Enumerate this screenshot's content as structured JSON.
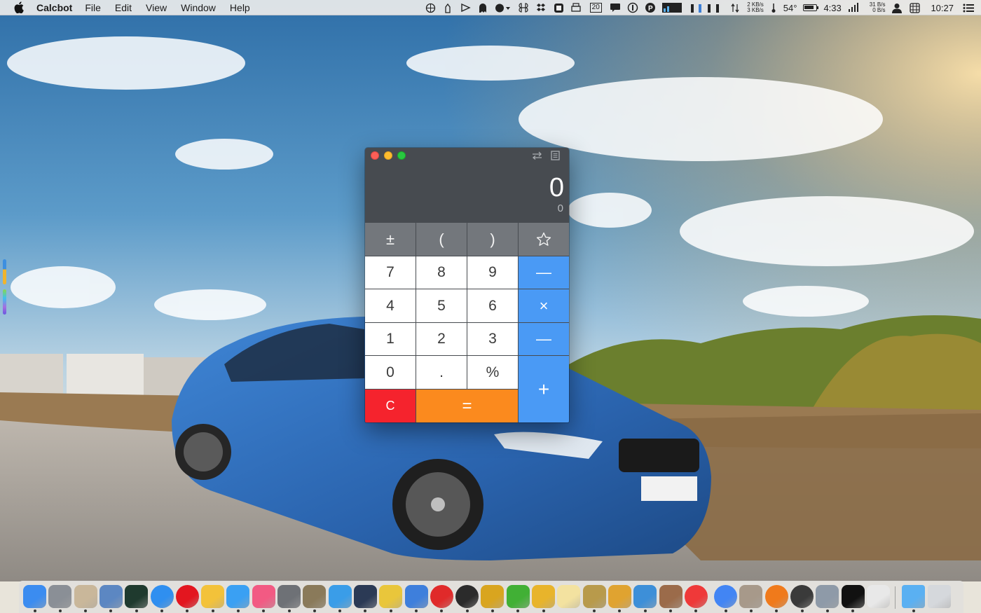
{
  "menubar": {
    "app_name": "Calcbot",
    "menus": [
      "File",
      "Edit",
      "View",
      "Window",
      "Help"
    ],
    "net_up": "2 KB/s",
    "net_down": "3 KB/s",
    "temperature": "54°",
    "battery_time": "4:33",
    "counter": "20",
    "io_up": "31 B/s",
    "io_down": "0 B/s",
    "clock": "10:27"
  },
  "calcbot": {
    "display": {
      "main_value": "0",
      "sub_value": "0"
    },
    "keys": {
      "plus_minus": "±",
      "paren_open": "(",
      "paren_close": ")",
      "seven": "7",
      "eight": "8",
      "nine": "9",
      "divide": "—",
      "four": "4",
      "five": "5",
      "six": "6",
      "multiply": "×",
      "one": "1",
      "two": "2",
      "three": "3",
      "minus": "—",
      "zero": "0",
      "decimal": ".",
      "percent": "%",
      "plus": "+",
      "clear": "C",
      "equals": "="
    },
    "colors": {
      "function_key": "#73777c",
      "number_key": "#ffffff",
      "operator_key": "#4a9af5",
      "clear_key": "#f5232d",
      "equals_key": "#fb8a1e",
      "display_bg": "#474b50"
    }
  },
  "dock": {
    "apps": [
      {
        "icon": "finder-icon",
        "color": "#3b8cf0"
      },
      {
        "icon": "launchpad-icon",
        "color": "#8a8f96"
      },
      {
        "icon": "utility-tools-icon",
        "color": "#c9b79a"
      },
      {
        "icon": "preview-icon",
        "color": "#5c87c2"
      },
      {
        "icon": "activity-monitor-icon",
        "color": "#1f3a2e"
      },
      {
        "icon": "safari-icon",
        "color": "#2f8ff0"
      },
      {
        "icon": "opera-icon",
        "color": "#e3161f"
      },
      {
        "icon": "photos-icon",
        "color": "#f3c23a"
      },
      {
        "icon": "app-store-icon",
        "color": "#3aa0f3"
      },
      {
        "icon": "itunes-icon",
        "color": "#f25a83"
      },
      {
        "icon": "system-preferences-icon",
        "color": "#6e7176"
      },
      {
        "icon": "package-icon",
        "color": "#8a7a5a"
      },
      {
        "icon": "tweetbot-icon",
        "color": "#3a9de8"
      },
      {
        "icon": "calendar-grid-icon",
        "color": "#2b3a55"
      },
      {
        "icon": "butterfly-icon",
        "color": "#e9c63b"
      },
      {
        "icon": "tasks-check-icon",
        "color": "#3e7fdc"
      },
      {
        "icon": "netease-music-icon",
        "color": "#e02a2a"
      },
      {
        "icon": "screen-record-icon",
        "color": "#2b2b2b"
      },
      {
        "icon": "forklift-icon",
        "color": "#d9a51f"
      },
      {
        "icon": "wechat-icon",
        "color": "#41b035"
      },
      {
        "icon": "cyberduck-icon",
        "color": "#e8b42b"
      },
      {
        "icon": "notes-pad-icon",
        "color": "#f3e2a0"
      },
      {
        "icon": "notebook-icon",
        "color": "#b89a4b"
      },
      {
        "icon": "image-viewer-icon",
        "color": "#e0a330"
      },
      {
        "icon": "cloud-app-icon",
        "color": "#3d8fd8"
      },
      {
        "icon": "fetch-icon",
        "color": "#9b6b4a"
      },
      {
        "icon": "vivaldi-icon",
        "color": "#ef3939"
      },
      {
        "icon": "chrome-icon",
        "color": "#4285f4"
      },
      {
        "icon": "archive-utility-icon",
        "color": "#a7998a"
      },
      {
        "icon": "firefox-icon",
        "color": "#f07a1b"
      },
      {
        "icon": "alfred-icon",
        "color": "#3a3a3a"
      },
      {
        "icon": "disk-utility-icon",
        "color": "#8e9aa8"
      },
      {
        "icon": "qq-icon",
        "color": "#111111"
      },
      {
        "icon": "text-edit-icon",
        "color": "#e8e8e8"
      },
      {
        "icon": "downloads-folder-icon",
        "color": "#5ab0f2"
      },
      {
        "icon": "trash-icon",
        "color": "#d5d8dc"
      }
    ]
  }
}
